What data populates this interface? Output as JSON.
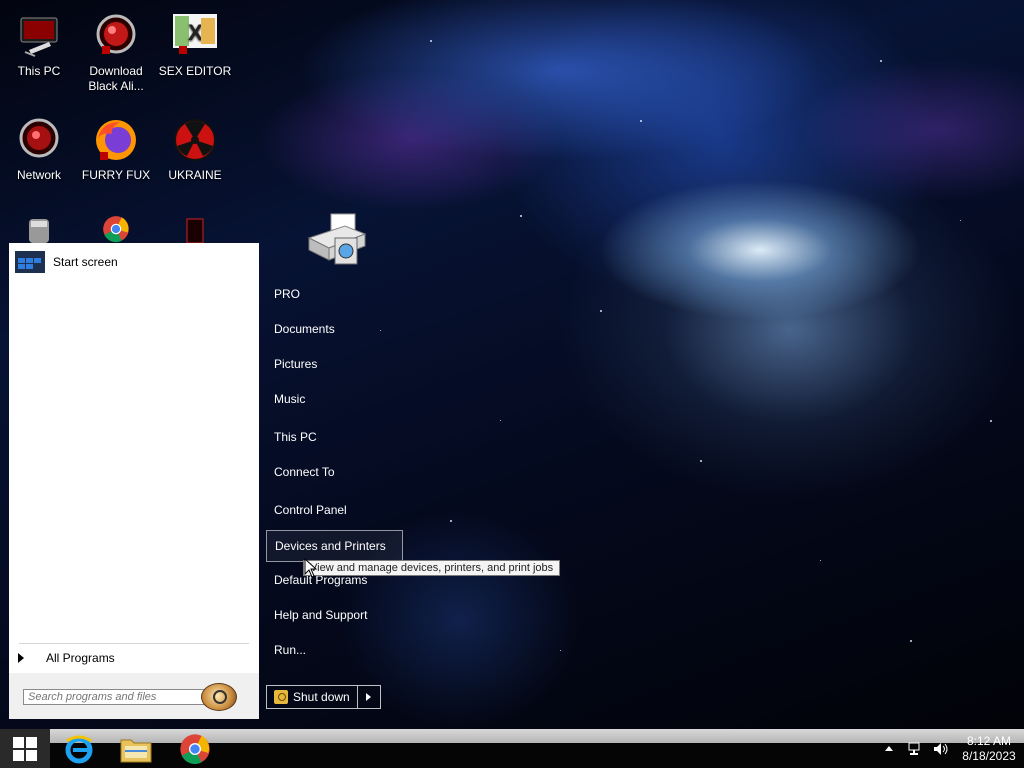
{
  "desktop": {
    "icons": [
      {
        "label": "This PC",
        "icon": "this-pc-icon"
      },
      {
        "label": "Download Black Ali...",
        "icon": "download-icon"
      },
      {
        "label": "SEX EDITOR",
        "icon": "hex-editor-icon"
      },
      {
        "label": "Network",
        "icon": "network-icon"
      },
      {
        "label": "FURRY FUX",
        "icon": "firefox-icon"
      },
      {
        "label": "UKRAINE",
        "icon": "radiation-icon"
      }
    ],
    "partial_icons": [
      "disk-icon",
      "chrome-icon",
      "app-icon"
    ]
  },
  "start_menu": {
    "pinned": [
      {
        "label": "Start screen",
        "icon": "start-screen-icon"
      }
    ],
    "all_programs": "All Programs",
    "search_placeholder": "Search programs and files",
    "right_items": [
      "PRO",
      "Documents",
      "Pictures",
      "Music",
      "This PC",
      "Connect To",
      "Control Panel",
      "Devices and Printers",
      "Default Programs",
      "Help and Support",
      "Run..."
    ],
    "highlighted_item": "Devices and Printers",
    "tooltip": "View and manage devices, printers, and print jobs",
    "shutdown": "Shut down"
  },
  "taskbar": {
    "pinned": [
      "internet-explorer-icon",
      "file-explorer-icon",
      "chrome-icon"
    ],
    "tray_icons": [
      "show-hidden-icons-icon",
      "network-status-icon",
      "volume-icon"
    ],
    "time": "8:12 AM",
    "date": "8/18/2023"
  },
  "colors": {
    "start_menu_bg": "#ffffff",
    "taskbar_bg": "#050505",
    "accent_blue": "#2f7de0"
  }
}
